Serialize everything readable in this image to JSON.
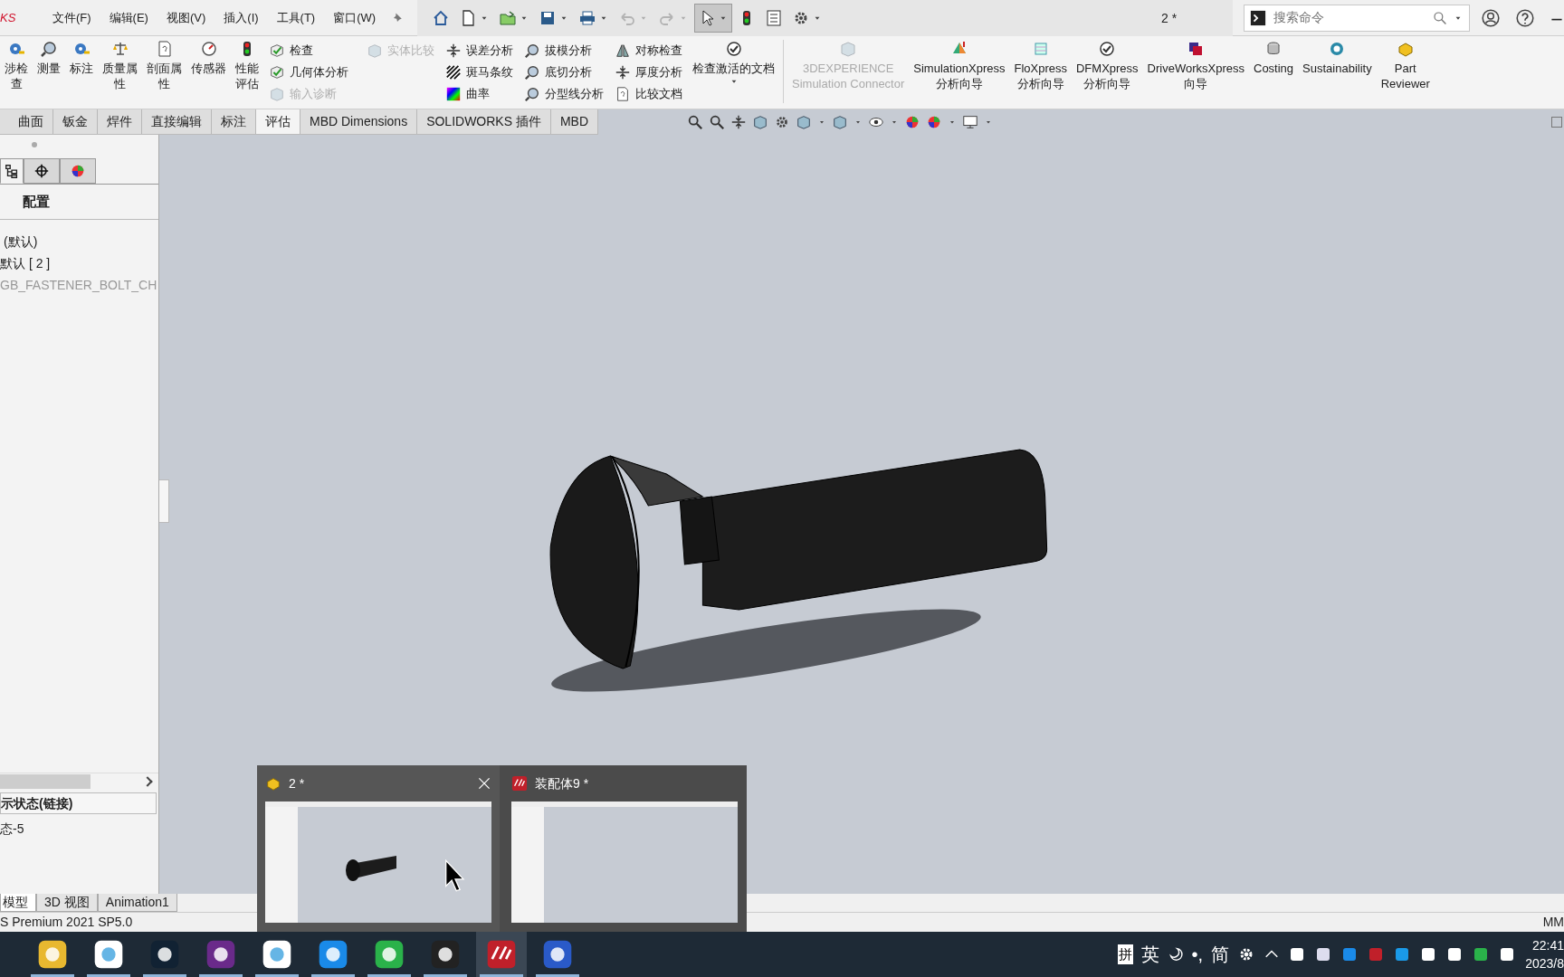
{
  "menu_bar": {
    "logo": "KS",
    "menu": [
      "文件(F)",
      "编辑(E)",
      "视图(V)",
      "插入(I)",
      "工具(T)",
      "窗口(W)"
    ],
    "quick_tools": [
      {
        "selected": false,
        "disabled": false
      },
      {
        "selected": false,
        "disabled": false
      },
      {
        "selected": false,
        "disabled": false
      },
      {
        "selected": false,
        "disabled": false
      },
      {
        "selected": false,
        "disabled": false
      },
      {
        "selected": false,
        "disabled": true
      },
      {
        "selected": false,
        "disabled": true
      },
      {
        "selected": true,
        "disabled": false
      },
      {
        "selected": false,
        "disabled": false
      },
      {
        "selected": false,
        "disabled": false
      },
      {
        "selected": false,
        "disabled": false
      }
    ],
    "document_title": "2 *",
    "search": {
      "placeholder": "搜索命令"
    }
  },
  "ribbon": {
    "sections": [
      {
        "kind": "large",
        "label": "涉检查",
        "disabled": false
      },
      {
        "kind": "large",
        "label": "测量",
        "disabled": false
      },
      {
        "kind": "large",
        "label": "标注",
        "disabled": false
      },
      {
        "kind": "large",
        "label": "质量属性",
        "disabled": false
      },
      {
        "kind": "large",
        "label": "剖面属性",
        "disabled": false
      },
      {
        "kind": "large",
        "label": "传感器",
        "disabled": false
      },
      {
        "kind": "large",
        "label": "性能评估",
        "disabled": false
      },
      {
        "kind": "column",
        "items": [
          {
            "label": "检查",
            "disabled": false
          },
          {
            "label": "几何体分析",
            "disabled": false
          },
          {
            "label": "输入诊断",
            "disabled": true
          }
        ]
      },
      {
        "kind": "column",
        "items": [
          {
            "label": "实体比较",
            "disabled": true
          }
        ]
      },
      {
        "kind": "column",
        "items": [
          {
            "label": "误差分析",
            "disabled": false
          },
          {
            "label": "斑马条纹",
            "disabled": false
          },
          {
            "label": "曲率",
            "disabled": false
          }
        ]
      },
      {
        "kind": "column",
        "items": [
          {
            "label": "拔模分析",
            "disabled": false
          },
          {
            "label": "底切分析",
            "disabled": false
          },
          {
            "label": "分型线分析",
            "disabled": false
          }
        ]
      },
      {
        "kind": "column",
        "items": [
          {
            "label": "对称检查",
            "disabled": false
          },
          {
            "label": "厚度分析",
            "disabled": false
          },
          {
            "label": "比较文档",
            "disabled": false
          }
        ]
      },
      {
        "kind": "large",
        "label": "检查激活的文档",
        "disabled": false,
        "has_menu": true
      },
      {
        "kind": "separator"
      },
      {
        "kind": "large",
        "label": "3DEXPERIENCE\nSimulation Connector",
        "disabled": true
      },
      {
        "kind": "large",
        "label": "SimulationXpress\n分析向导",
        "disabled": false
      },
      {
        "kind": "large",
        "label": "FloXpress\n分析向导",
        "disabled": false
      },
      {
        "kind": "large",
        "label": "DFMXpress\n分析向导",
        "disabled": false
      },
      {
        "kind": "large",
        "label": "DriveWorksXpress\n向导",
        "disabled": false
      },
      {
        "kind": "large",
        "label": "Costing",
        "disabled": false
      },
      {
        "kind": "large",
        "label": "Sustainability",
        "disabled": false
      },
      {
        "kind": "large",
        "label": "Part\nReviewer",
        "disabled": false
      }
    ]
  },
  "command_tabs": [
    {
      "label": "曲面",
      "selected": false
    },
    {
      "label": "钣金",
      "selected": false
    },
    {
      "label": "焊件",
      "selected": false
    },
    {
      "label": "直接编辑",
      "selected": false
    },
    {
      "label": "标注",
      "selected": false
    },
    {
      "label": "评估",
      "selected": true
    },
    {
      "label": "MBD Dimensions",
      "selected": false
    },
    {
      "label": "SOLIDWORKS 插件",
      "selected": false
    },
    {
      "label": "MBD",
      "selected": false
    }
  ],
  "manager": {
    "tabs": [
      {
        "selected": true
      },
      {
        "selected": false
      },
      {
        "selected": false
      }
    ],
    "heading": "配置",
    "tree": [
      {
        "label": "(默认)",
        "disabled": false
      },
      {
        "label": "默认 [ 2 ]",
        "disabled": false
      },
      {
        "label": "GB_FASTENER_BOLT_CH",
        "disabled": true
      }
    ],
    "display_states_heading": "示状态(链接)",
    "display_states": [
      "态-5"
    ]
  },
  "model_tabs": [
    {
      "label": "模型",
      "selected": true
    },
    {
      "label": "3D 视图",
      "selected": false
    },
    {
      "label": "Animation1",
      "selected": false
    }
  ],
  "status_bar": {
    "product": "S Premium 2021 SP5.0",
    "units": "MM"
  },
  "window_previews": [
    {
      "title": "2 *",
      "hovered": true
    },
    {
      "title": "装配体9 *",
      "hovered": false
    }
  ],
  "taskbar": {
    "apps": [
      {
        "running": true,
        "selected": false
      },
      {
        "running": true,
        "selected": false
      },
      {
        "running": true,
        "selected": false
      },
      {
        "running": true,
        "selected": false
      },
      {
        "running": true,
        "selected": false
      },
      {
        "running": true,
        "selected": false
      },
      {
        "running": true,
        "selected": false
      },
      {
        "running": true,
        "selected": false
      },
      {
        "running": true,
        "selected": true
      },
      {
        "running": true,
        "selected": false
      }
    ],
    "input_method": [
      "拼",
      "英",
      "•,",
      "简"
    ],
    "clock": {
      "time": "22:41",
      "date": "2023/8"
    }
  }
}
